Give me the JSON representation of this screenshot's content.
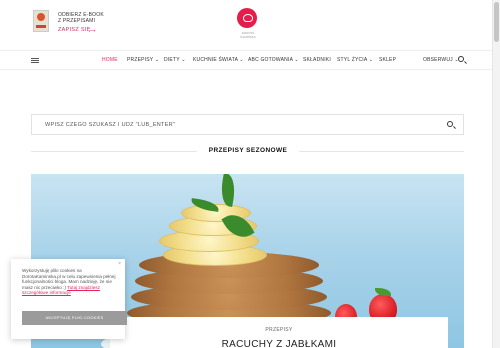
{
  "header": {
    "ebook_line1": "ODBIERZ E-BOOK",
    "ebook_line2": "Z PRZEPISAMI",
    "ebook_link": "ZAPISZ SIĘ",
    "logo_sub": "DOROTA KAMIŃSKA"
  },
  "nav": {
    "items": [
      {
        "label": "HOME"
      },
      {
        "label": "PRZEPISY ⌄"
      },
      {
        "label": "DIETY ⌄"
      },
      {
        "label": "KUCHNIE ŚWIATA ⌄"
      },
      {
        "label": "ABC GOTOWANIA ⌄"
      },
      {
        "label": "SKŁADNIKI"
      },
      {
        "label": "STYL ŻYCIA ⌄"
      },
      {
        "label": "SKLEP"
      },
      {
        "label": "OBSERWUJ ⌄"
      }
    ]
  },
  "search": {
    "placeholder": "WPISZ CZEGO SZUKASZ I UDŹ \"LUB_ENTER\""
  },
  "section": {
    "title": "PRZEPISY SEZONOWE"
  },
  "hero": {
    "category": "PRZEPISY",
    "title": "RACUCHY Z JABŁKAMI"
  },
  "cookie": {
    "text": "Wykorzystuję pliki cookies na DorotaKaminska.pl w celu zapewnienia pełnej funkcjonalności bloga. Mam nadzieję, że nie masz nic przeciwko :)",
    "link": "Tutaj znajdziesz szczegółowe informacje",
    "close": "×",
    "button": "AKCEPTUJĘ PLIKI COOKIES"
  },
  "colors": {
    "accent": "#e2275d",
    "logo": "#e41d4b"
  }
}
